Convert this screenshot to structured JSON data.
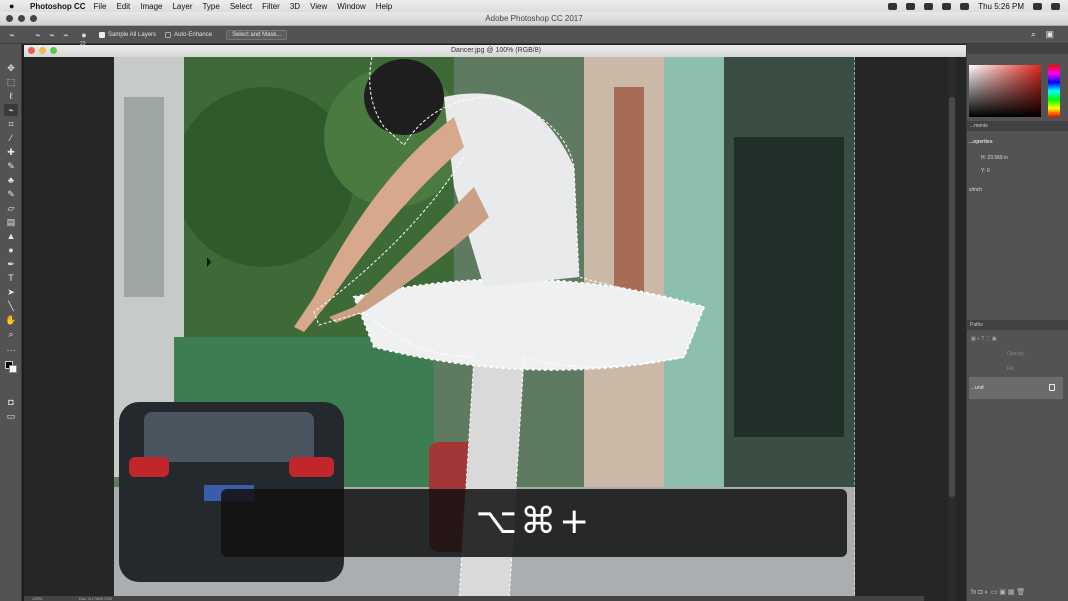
{
  "menubar": {
    "app_name": "Photoshop CC",
    "items": [
      "File",
      "Edit",
      "Image",
      "Layer",
      "Type",
      "Select",
      "Filter",
      "3D",
      "View",
      "Window",
      "Help"
    ],
    "clock": "Thu 5:26 PM"
  },
  "window": {
    "title": "Adobe Photoshop CC 2017"
  },
  "options_bar": {
    "brush_size": "23",
    "sample_all_layers_label": "Sample All Layers",
    "sample_all_layers_checked": true,
    "auto_enhance_label": "Auto-Enhance",
    "auto_enhance_checked": false,
    "select_and_mask_label": "Select and Mask..."
  },
  "document": {
    "tab_title": "Dancer.jpg @ 100% (RGB/8)",
    "zoom": "100%",
    "doc_size": "Doc: 6.17M/6.17M"
  },
  "panels": {
    "comments_tab": "...ments",
    "properties_tab": "...operties",
    "height_label": "H: 23.569 in",
    "y_label": "Y: 0",
    "resolution_label": "s/inch",
    "paths_tab": "Paths",
    "opacity_label": "Opacity:",
    "fill_label": "Fill:",
    "layer_name": "...und"
  },
  "overlay": {
    "shortcut": "⌥⌘+"
  },
  "colors": {
    "panel_bg": "#535353",
    "toolbar_bg": "#535353",
    "foreground": "#000000",
    "background": "#ffffff"
  }
}
